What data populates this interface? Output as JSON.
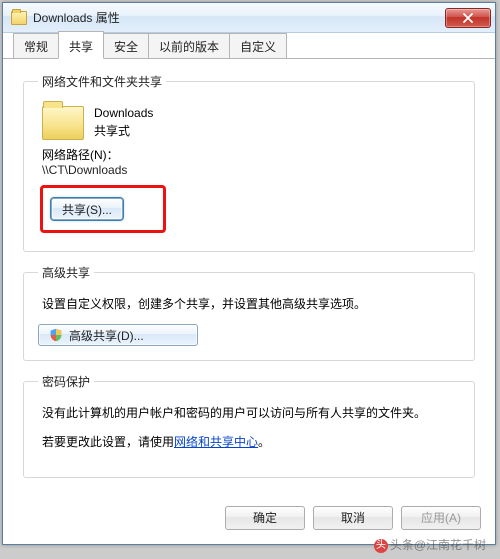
{
  "window": {
    "title": "Downloads 属性"
  },
  "tabs": {
    "general": "常规",
    "share": "共享",
    "security": "安全",
    "previous": "以前的版本",
    "custom": "自定义"
  },
  "section_netshare": {
    "legend": "网络文件和文件夹共享",
    "folder_name": "Downloads",
    "share_state": "共享式",
    "netpath_label": "网络路径(N)：",
    "netpath_value": "\\\\CT\\Downloads",
    "share_btn": "共享(S)..."
  },
  "section_advshare": {
    "legend": "高级共享",
    "desc": "设置自定义权限，创建多个共享，并设置其他高级共享选项。",
    "btn": "高级共享(D)..."
  },
  "section_pw": {
    "legend": "密码保护",
    "desc1": "没有此计算机的用户帐户和密码的用户可以访问与所有人共享的文件夹。",
    "desc2a": "若要更改此设置，请使用",
    "link": "网络和共享中心",
    "desc2b": "。"
  },
  "buttons": {
    "ok": "确定",
    "cancel": "取消",
    "apply": "应用(A)"
  },
  "watermark": "头条@江南花千树"
}
